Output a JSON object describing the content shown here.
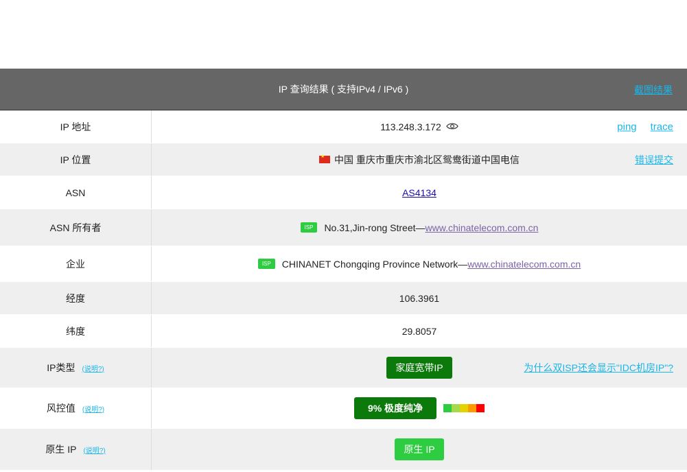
{
  "header": {
    "title": "IP 查询结果 ( 支持IPv4 / IPv6 )",
    "screenshot_link": "截图结果"
  },
  "rows": {
    "ip": {
      "label": "IP 地址",
      "value": "113.248.3.172",
      "ping": "ping",
      "trace": "trace"
    },
    "location": {
      "label": "IP 位置",
      "value": "中国  重庆市重庆市渝北区鸳鸯街道中国电信",
      "report": "错误提交"
    },
    "asn": {
      "label": "ASN",
      "value": "AS4134"
    },
    "asn_owner": {
      "label": "ASN 所有者",
      "isp": "ISP",
      "text": "No.31,Jin-rong Street— ",
      "link": "www.chinatelecom.com.cn"
    },
    "org": {
      "label": "企业",
      "isp": "ISP",
      "text": "CHINANET Chongqing Province Network— ",
      "link": "www.chinatelecom.com.cn"
    },
    "longitude": {
      "label": "经度",
      "value": "106.3961"
    },
    "latitude": {
      "label": "纬度",
      "value": "29.8057"
    },
    "ip_type": {
      "label": "IP类型",
      "help": "(说明?)",
      "badge": "家庭宽带IP",
      "question": "为什么双ISP还会显示\"IDC机房IP\"?"
    },
    "risk": {
      "label": "风控值",
      "help": "(说明?)",
      "badge": "9%   极度纯净",
      "score": 0.09
    },
    "native": {
      "label": "原生 IP",
      "help": "(说明?)",
      "badge": "原生 IP"
    }
  },
  "colors": {
    "accent": "#19b6ea",
    "header_bg": "#666666",
    "badge_dark": "#0b7a0b",
    "badge_light": "#2ecc40"
  },
  "risk_colors": [
    "#2ecc40",
    "#a8d84c",
    "#e3d400",
    "#ff9900",
    "#ff0000"
  ]
}
